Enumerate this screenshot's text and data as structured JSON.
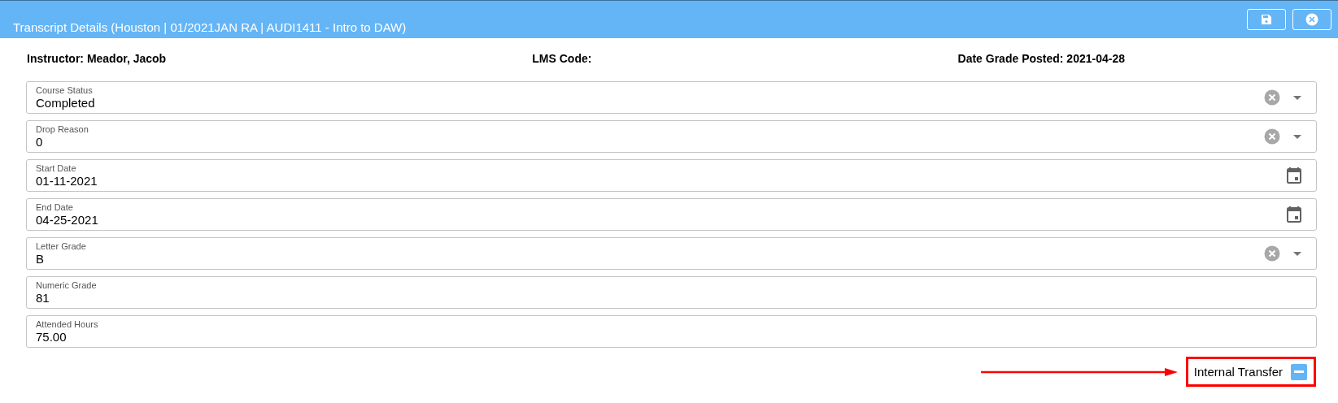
{
  "window": {
    "title": "Transcript Details (Houston | 01/2021JAN RA | AUDI1411 - Intro to DAW)"
  },
  "header_buttons": [
    {
      "kind": "save"
    },
    {
      "kind": "close"
    }
  ],
  "info": [
    {
      "label": "Instructor:",
      "value": "Meador, Jacob"
    },
    {
      "label": "LMS Code:"
    },
    {
      "label": "Date Grade Posted:",
      "value": "2021-04-28"
    }
  ],
  "fields": [
    {
      "kind": "select",
      "label": "Course Status",
      "value": "Completed"
    },
    {
      "kind": "select",
      "label": "Drop Reason",
      "value": "0"
    },
    {
      "kind": "date",
      "label": "Start Date",
      "value": "01-11-2021"
    },
    {
      "kind": "date",
      "label": "End Date",
      "value": "04-25-2021"
    },
    {
      "kind": "select",
      "label": "Letter Grade",
      "value": "B"
    },
    {
      "kind": "text",
      "label": "Numeric Grade",
      "value": "81"
    },
    {
      "kind": "text",
      "label": "Attended Hours",
      "value": "75.00"
    }
  ],
  "internal_transfer": {
    "label": "Internal Transfer",
    "indeterminate": true,
    "highlighted": true
  }
}
